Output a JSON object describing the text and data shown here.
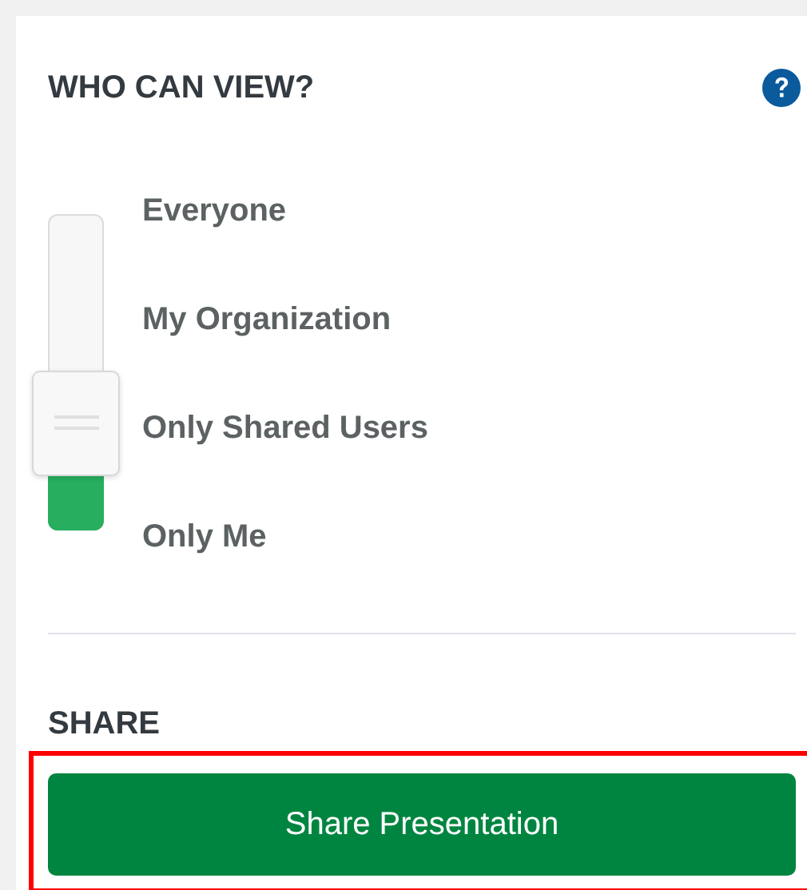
{
  "who_can_view": {
    "title": "WHO CAN VIEW?",
    "slider": {
      "level": 0.34
    },
    "options": [
      {
        "label": "Everyone"
      },
      {
        "label": "My Organization"
      },
      {
        "label": "Only Shared Users"
      },
      {
        "label": "Only Me"
      }
    ]
  },
  "share": {
    "title": "SHARE",
    "button": "Share Presentation",
    "highlighted": true
  }
}
